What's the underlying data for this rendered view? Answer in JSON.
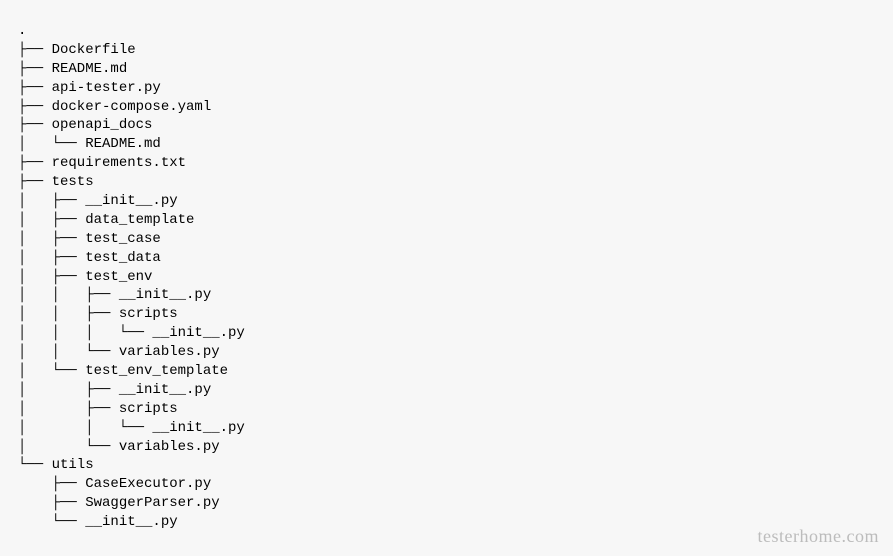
{
  "tree_lines": [
    ".",
    "├── Dockerfile",
    "├── README.md",
    "├── api-tester.py",
    "├── docker-compose.yaml",
    "├── openapi_docs",
    "│   └── README.md",
    "├── requirements.txt",
    "├── tests",
    "│   ├── __init__.py",
    "│   ├── data_template",
    "│   ├── test_case",
    "│   ├── test_data",
    "│   ├── test_env",
    "│   │   ├── __init__.py",
    "│   │   ├── scripts",
    "│   │   │   └── __init__.py",
    "│   │   └── variables.py",
    "│   └── test_env_template",
    "│       ├── __init__.py",
    "│       ├── scripts",
    "│       │   └── __init__.py",
    "│       └── variables.py",
    "└── utils",
    "    ├── CaseExecutor.py",
    "    ├── SwaggerParser.py",
    "    └── __init__.py"
  ],
  "watermark": "testerhome.com"
}
